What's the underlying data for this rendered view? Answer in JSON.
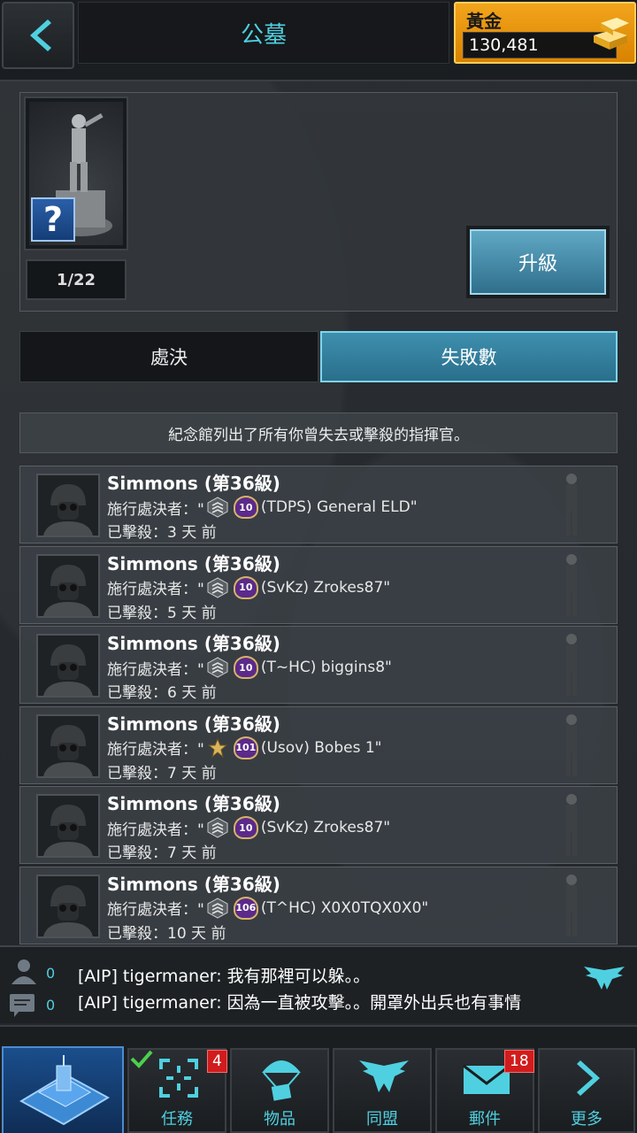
{
  "header": {
    "title": "公墓",
    "gold_label": "黃金",
    "gold_value": "130,481"
  },
  "statue": {
    "progress": "1/22",
    "upgrade_label": "升級"
  },
  "tabs": [
    {
      "label": "處決",
      "active": false
    },
    {
      "label": "失敗數",
      "active": true
    }
  ],
  "info_text": "紀念館列出了所有你曾失去或擊殺的指揮官。",
  "rows": [
    {
      "name": "Simmons (第36級)",
      "by_prefix": "施行處決者：\"",
      "rank": "sergeant",
      "level": "10",
      "by_name": "(TDPS) General ELD\"",
      "killed": "已擊殺：3 天 前"
    },
    {
      "name": "Simmons (第36級)",
      "by_prefix": "施行處決者：\"",
      "rank": "sergeant",
      "level": "10",
      "by_name": "(SvKz) Zrokes87\"",
      "killed": "已擊殺：5 天 前"
    },
    {
      "name": "Simmons (第36級)",
      "by_prefix": "施行處決者：\"",
      "rank": "sergeant",
      "level": "10",
      "by_name": "(T~HC) biggins8\"",
      "killed": "已擊殺：6 天 前"
    },
    {
      "name": "Simmons (第36級)",
      "by_prefix": "施行處決者：\"",
      "rank": "star",
      "level": "101",
      "by_name": "(Usov) Bobes  1\"",
      "killed": "已擊殺：7 天 前"
    },
    {
      "name": "Simmons (第36級)",
      "by_prefix": "施行處決者：\"",
      "rank": "sergeant",
      "level": "10",
      "by_name": "(SvKz) Zrokes87\"",
      "killed": "已擊殺：7 天 前"
    },
    {
      "name": "Simmons (第36級)",
      "by_prefix": "施行處決者：\"",
      "rank": "sergeant",
      "level": "106",
      "by_name": "(T^HC) X0X0TQX0X0\"",
      "killed": "已擊殺：10 天 前"
    }
  ],
  "chat": {
    "person_count": "0",
    "message_count": "0",
    "line1": "[AIP] tigermaner: 我有那裡可以躲。。",
    "line2": "[AIP] tigermaner: 因為一直被攻擊。。開罩外出兵也有事情"
  },
  "nav": {
    "missions_label": "任務",
    "missions_badge": "4",
    "items_label": "物品",
    "alliance_label": "同盟",
    "mail_label": "郵件",
    "mail_badge": "18",
    "more_label": "更多"
  },
  "colors": {
    "accent": "#4fd0e0",
    "gold": "#f2a51c",
    "badge_red": "#d01c1c"
  }
}
